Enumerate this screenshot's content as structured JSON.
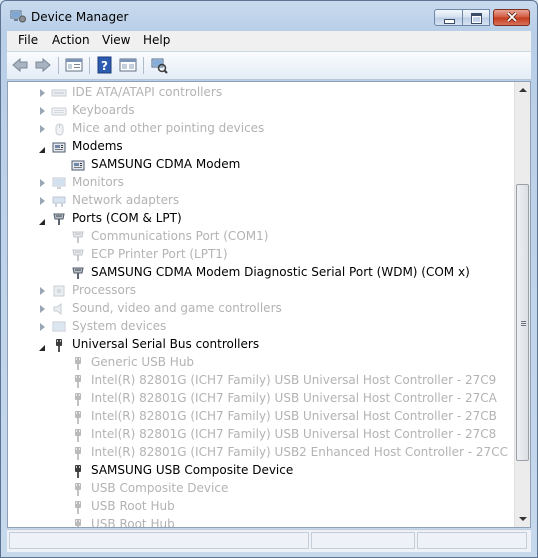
{
  "window": {
    "title": "Device Manager"
  },
  "menu": {
    "file": "File",
    "action": "Action",
    "view": "View",
    "help": "Help"
  },
  "tree": [
    {
      "label": "IDE ATA/ATAPI controllers",
      "level": 1,
      "state": "faded",
      "expander": "collapsed",
      "icon": "ide-controller-icon"
    },
    {
      "label": "Keyboards",
      "level": 1,
      "state": "faded",
      "expander": "collapsed",
      "icon": "keyboard-icon"
    },
    {
      "label": "Mice and other pointing devices",
      "level": 1,
      "state": "faded",
      "expander": "collapsed",
      "icon": "mouse-icon"
    },
    {
      "label": "Modems",
      "level": 1,
      "state": "active",
      "expander": "expanded",
      "icon": "modem-icon"
    },
    {
      "label": "SAMSUNG CDMA Modem",
      "level": 2,
      "state": "active",
      "expander": "none",
      "icon": "modem-icon"
    },
    {
      "label": "Monitors",
      "level": 1,
      "state": "faded",
      "expander": "collapsed",
      "icon": "monitor-icon"
    },
    {
      "label": "Network adapters",
      "level": 1,
      "state": "faded",
      "expander": "collapsed",
      "icon": "network-adapter-icon"
    },
    {
      "label": "Ports (COM & LPT)",
      "level": 1,
      "state": "active",
      "expander": "expanded",
      "icon": "port-icon"
    },
    {
      "label": "Communications Port (COM1)",
      "level": 2,
      "state": "faded",
      "expander": "none",
      "icon": "port-icon"
    },
    {
      "label": "ECP Printer Port (LPT1)",
      "level": 2,
      "state": "faded",
      "expander": "none",
      "icon": "port-icon"
    },
    {
      "label": "SAMSUNG CDMA Modem Diagnostic Serial Port (WDM) (COM x)",
      "level": 2,
      "state": "active",
      "expander": "none",
      "icon": "port-icon"
    },
    {
      "label": "Processors",
      "level": 1,
      "state": "faded",
      "expander": "collapsed",
      "icon": "processor-icon"
    },
    {
      "label": "Sound, video and game controllers",
      "level": 1,
      "state": "faded",
      "expander": "collapsed",
      "icon": "sound-icon"
    },
    {
      "label": "System devices",
      "level": 1,
      "state": "faded",
      "expander": "collapsed",
      "icon": "system-device-icon"
    },
    {
      "label": "Universal Serial Bus controllers",
      "level": 1,
      "state": "active",
      "expander": "expanded",
      "icon": "usb-icon"
    },
    {
      "label": "Generic USB Hub",
      "level": 2,
      "state": "faded",
      "expander": "none",
      "icon": "usb-icon"
    },
    {
      "label": "Intel(R) 82801G (ICH7 Family) USB Universal Host Controller - 27C9",
      "level": 2,
      "state": "faded",
      "expander": "none",
      "icon": "usb-icon"
    },
    {
      "label": "Intel(R) 82801G (ICH7 Family) USB Universal Host Controller - 27CA",
      "level": 2,
      "state": "faded",
      "expander": "none",
      "icon": "usb-icon"
    },
    {
      "label": "Intel(R) 82801G (ICH7 Family) USB Universal Host Controller - 27CB",
      "level": 2,
      "state": "faded",
      "expander": "none",
      "icon": "usb-icon"
    },
    {
      "label": "Intel(R) 82801G (ICH7 Family) USB Universal Host Controller - 27C8",
      "level": 2,
      "state": "faded",
      "expander": "none",
      "icon": "usb-icon"
    },
    {
      "label": "Intel(R) 82801G (ICH7 Family) USB2 Enhanced Host Controller - 27CC",
      "level": 2,
      "state": "faded",
      "expander": "none",
      "icon": "usb-icon"
    },
    {
      "label": "SAMSUNG USB Composite Device",
      "level": 2,
      "state": "active",
      "expander": "none",
      "icon": "usb-icon"
    },
    {
      "label": "USB Composite Device",
      "level": 2,
      "state": "faded",
      "expander": "none",
      "icon": "usb-icon"
    },
    {
      "label": "USB Root Hub",
      "level": 2,
      "state": "faded",
      "expander": "none",
      "icon": "usb-icon"
    },
    {
      "label": "USB Root Hub",
      "level": 2,
      "state": "faded",
      "expander": "none",
      "icon": "usb-icon"
    }
  ]
}
